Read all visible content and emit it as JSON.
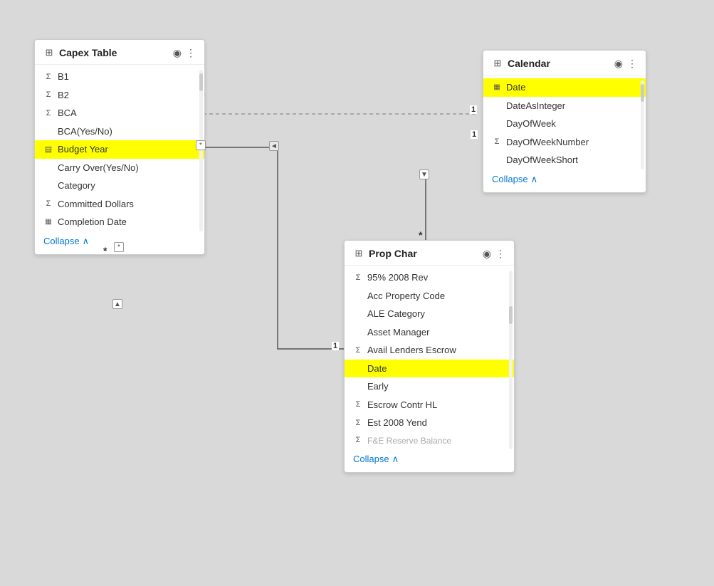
{
  "capex_table": {
    "title": "Capex Table",
    "fields": [
      {
        "name": "B1",
        "icon": "sigma",
        "highlighted": false
      },
      {
        "name": "B2",
        "icon": "sigma",
        "highlighted": false
      },
      {
        "name": "BCA",
        "icon": "sigma",
        "highlighted": false
      },
      {
        "name": "BCA(Yes/No)",
        "icon": "",
        "highlighted": false
      },
      {
        "name": "Budget Year",
        "icon": "table",
        "highlighted": true
      },
      {
        "name": "Carry Over(Yes/No)",
        "icon": "",
        "highlighted": false
      },
      {
        "name": "Category",
        "icon": "",
        "highlighted": false
      },
      {
        "name": "Committed Dollars",
        "icon": "sigma",
        "highlighted": false
      },
      {
        "name": "Completion Date",
        "icon": "calendar",
        "highlighted": false
      }
    ],
    "collapse_label": "Collapse"
  },
  "calendar_table": {
    "title": "Calendar",
    "fields": [
      {
        "name": "Date",
        "icon": "calendar",
        "highlighted": true
      },
      {
        "name": "DateAsInteger",
        "icon": "",
        "highlighted": false
      },
      {
        "name": "DayOfWeek",
        "icon": "",
        "highlighted": false
      },
      {
        "name": "DayOfWeekNumber",
        "icon": "sigma",
        "highlighted": false
      },
      {
        "name": "DayOfWeekShort",
        "icon": "",
        "highlighted": false
      }
    ],
    "collapse_label": "Collapse"
  },
  "prop_char_table": {
    "title": "Prop Char",
    "fields": [
      {
        "name": "95% 2008 Rev",
        "icon": "sigma",
        "highlighted": false
      },
      {
        "name": "Acc Property Code",
        "icon": "",
        "highlighted": false
      },
      {
        "name": "ALE Category",
        "icon": "",
        "highlighted": false
      },
      {
        "name": "Asset Manager",
        "icon": "",
        "highlighted": false
      },
      {
        "name": "Avail Lenders Escrow",
        "icon": "sigma",
        "highlighted": false
      },
      {
        "name": "Date",
        "icon": "",
        "highlighted": true
      },
      {
        "name": "Early",
        "icon": "",
        "highlighted": false
      },
      {
        "name": "Escrow Contr HL",
        "icon": "sigma",
        "highlighted": false
      },
      {
        "name": "Est 2008 Yend",
        "icon": "sigma",
        "highlighted": false
      },
      {
        "name": "F&E Reserve Balance",
        "icon": "sigma",
        "highlighted": false
      }
    ],
    "collapse_label": "Collapse"
  },
  "icons": {
    "sigma": "Σ",
    "calendar": "▦",
    "table": "▤",
    "eye": "◉",
    "more": "⋮",
    "collapse_arrow": "∧",
    "arrow_left": "◄",
    "arrow_down": "▼",
    "arrow_up": "▲"
  },
  "relationship_labels": {
    "one": "1",
    "many": "*"
  }
}
